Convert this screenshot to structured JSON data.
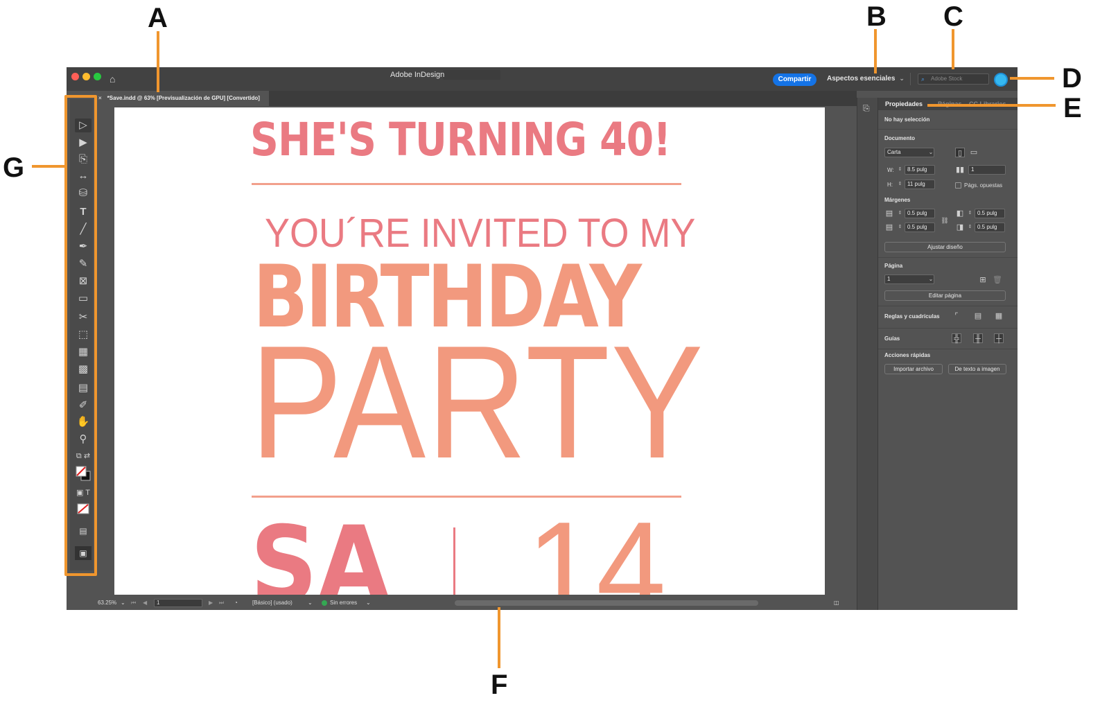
{
  "callouts": [
    "A",
    "B",
    "C",
    "D",
    "E",
    "F",
    "G"
  ],
  "colors": {
    "callout_line": "#f0962e",
    "accent_blue": "#1473e6",
    "headline_pink": "#ea7a82",
    "headline_salmon": "#f2997e",
    "status_ok": "#34a853"
  },
  "titlebar": {
    "app_title": "Adobe InDesign",
    "share_label": "Compartir",
    "workspace_label": "Aspectos esenciales",
    "stock_placeholder": "Adobe Stock",
    "icons": [
      "home-icon",
      "search-icon",
      "avatar"
    ]
  },
  "document_tab": {
    "label": "*Save.indd @ 63% [Previsualización de GPU] [Convertido]"
  },
  "tools": {
    "icons": [
      "selection-tool-icon",
      "direct-selection-tool-icon",
      "page-tool-icon",
      "gap-tool-icon",
      "content-collector-icon",
      "type-tool-icon",
      "line-tool-icon",
      "pen-tool-icon",
      "pencil-tool-icon",
      "rectangle-frame-icon",
      "rectangle-tool-icon",
      "scissors-icon",
      "free-transform-icon",
      "gradient-swatch-icon",
      "gradient-feather-icon",
      "note-tool-icon",
      "eyedropper-icon",
      "hand-tool-icon",
      "zoom-tool-icon",
      "default-fill-stroke-icon",
      "fill-stroke-swatch-icon",
      "formatting-affects-container-icon",
      "apply-none-icon",
      "view-mode-icon",
      "screen-mode-icon"
    ]
  },
  "document": {
    "line1": "SHE'S TURNING 40!",
    "line2": "YOU´RE INVITED TO MY",
    "line3": "BIRTHDAY",
    "line4": "PARTY",
    "line5": "SA",
    "line6": "14"
  },
  "statusbar": {
    "zoom": "63.25%",
    "page": "1",
    "preflight_profile": "[Básico] (usado)",
    "preflight_status": "Sin errores"
  },
  "properties_panel": {
    "tabs": [
      "Propiedades",
      "Páginas",
      "CC Libraries"
    ],
    "selection_status": "No hay selección",
    "document_section": "Documento",
    "page_size": "Carta",
    "width_label": "W:",
    "width": "8.5 pulg",
    "height_label": "H:",
    "height": "11 pulg",
    "pages_count": "1",
    "facing_pages_label": "Págs. opuestas",
    "margins_section": "Márgenes",
    "margin_top": "0.5 pulg",
    "margin_bottom": "0.5 pulg",
    "margin_left": "0.5 pulg",
    "margin_right": "0.5 pulg",
    "adjust_layout_button": "Ajustar diseño",
    "page_section": "Página",
    "current_page": "1",
    "edit_page_button": "Editar página",
    "rulers_section": "Reglas y cuadrículas",
    "guides_section": "Guías",
    "quick_actions_section": "Acciones rápidas",
    "import_file_button": "Importar archivo",
    "text_to_image_button": "De texto a imagen"
  }
}
